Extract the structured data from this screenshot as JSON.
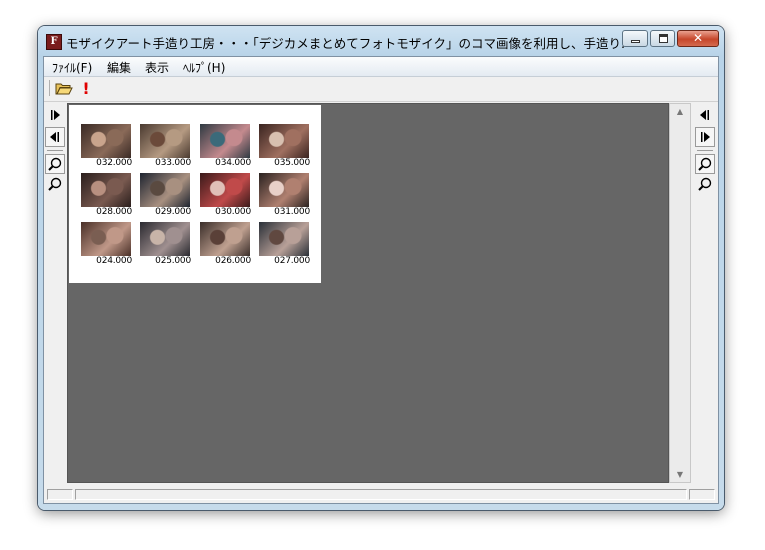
{
  "window": {
    "title": "モザイクアート手造り工房・・・「デジカメまとめてフォトモザイク」のコマ画像を利用し、手造り...",
    "app_icon_letter": "F",
    "close_glyph": "✕"
  },
  "menu": {
    "items": [
      {
        "label": "ﾌｧｲﾙ(F)"
      },
      {
        "label": "編集"
      },
      {
        "label": "表示"
      },
      {
        "label": "ﾍﾙﾌﾟ(H)"
      }
    ]
  },
  "toolbar": {
    "open_icon": "open-folder-icon",
    "exclamation_label": "!"
  },
  "side_left": {
    "icons": [
      "play-forward-icon",
      "play-back-icon",
      "zoom-out-icon",
      "zoom-in-icon"
    ]
  },
  "side_right": {
    "icons": [
      "play-back-icon",
      "play-forward-icon",
      "zoom-out-icon",
      "zoom-in-icon"
    ]
  },
  "scrollbar": {
    "up_glyph": "▲",
    "down_glyph": "▼"
  },
  "thumbnails": [
    {
      "label": "032.000",
      "colors": [
        "#3a2a25",
        "#8a6a58",
        "#c9a48c"
      ]
    },
    {
      "label": "033.000",
      "colors": [
        "#4a3a30",
        "#b59a82",
        "#6b4a3a"
      ]
    },
    {
      "label": "034.000",
      "colors": [
        "#2e3a42",
        "#c48a8e",
        "#3b6a7a"
      ]
    },
    {
      "label": "035.000",
      "colors": [
        "#3a2420",
        "#a07060",
        "#d8c0b0"
      ]
    },
    {
      "label": "028.000",
      "colors": [
        "#2a1e1c",
        "#7a5a50",
        "#b89080"
      ]
    },
    {
      "label": "029.000",
      "colors": [
        "#1e2430",
        "#a89080",
        "#5a4a40"
      ]
    },
    {
      "label": "030.000",
      "colors": [
        "#3a1a1a",
        "#c04a4a",
        "#e0c0b8"
      ]
    },
    {
      "label": "031.000",
      "colors": [
        "#2a2220",
        "#b08070",
        "#e8d0c8"
      ]
    },
    {
      "label": "024.000",
      "colors": [
        "#4a3028",
        "#c09888",
        "#7a5e52"
      ]
    },
    {
      "label": "025.000",
      "colors": [
        "#2a2a30",
        "#a09090",
        "#c8b4a8"
      ]
    },
    {
      "label": "026.000",
      "colors": [
        "#3a2e2a",
        "#bfa090",
        "#5a4038"
      ]
    },
    {
      "label": "027.000",
      "colors": [
        "#2a3038",
        "#b8a098",
        "#604840"
      ]
    }
  ],
  "colors": {
    "canvas_bg": "#666666",
    "sheet_bg": "#ffffff",
    "accent_red": "#e00000"
  }
}
